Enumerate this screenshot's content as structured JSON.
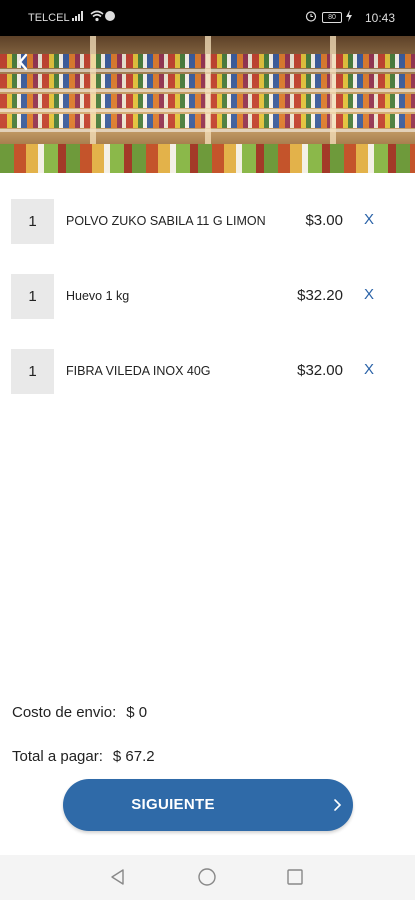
{
  "status_bar": {
    "carrier": "TELCEL",
    "time": "10:43",
    "battery": "80",
    "icons": [
      "signal-icon",
      "wifi-icon",
      "messenger-icon",
      "alarm-icon",
      "battery-icon",
      "charging-icon"
    ]
  },
  "hero": {
    "image": "grocery-store-shelves",
    "back_icon": "back-arrow-icon"
  },
  "cart": {
    "items": [
      {
        "qty": "1",
        "name": "POLVO ZUKO SABILA 11 G LIMON",
        "price": "$3.00",
        "remove": "X"
      },
      {
        "qty": "1",
        "name": "Huevo 1 kg",
        "price": "$32.20",
        "remove": "X"
      },
      {
        "qty": "1",
        "name": "FIBRA VILEDA INOX 40G",
        "price": "$32.00",
        "remove": "X"
      }
    ]
  },
  "summary": {
    "shipping_label": "Costo de envio:",
    "shipping_value": "$ 0",
    "total_label": "Total a pagar:",
    "total_value": "$ 67.2"
  },
  "next_button": {
    "label": "SIGUIENTE",
    "icon": "chevron-right-icon"
  },
  "nav_bar": {
    "icons": [
      "back-triangle-icon",
      "home-circle-icon",
      "recents-square-icon"
    ]
  },
  "colors": {
    "accent": "#2f6aa8",
    "remove": "#2b63a8",
    "qty_bg": "#e9e9e9"
  }
}
